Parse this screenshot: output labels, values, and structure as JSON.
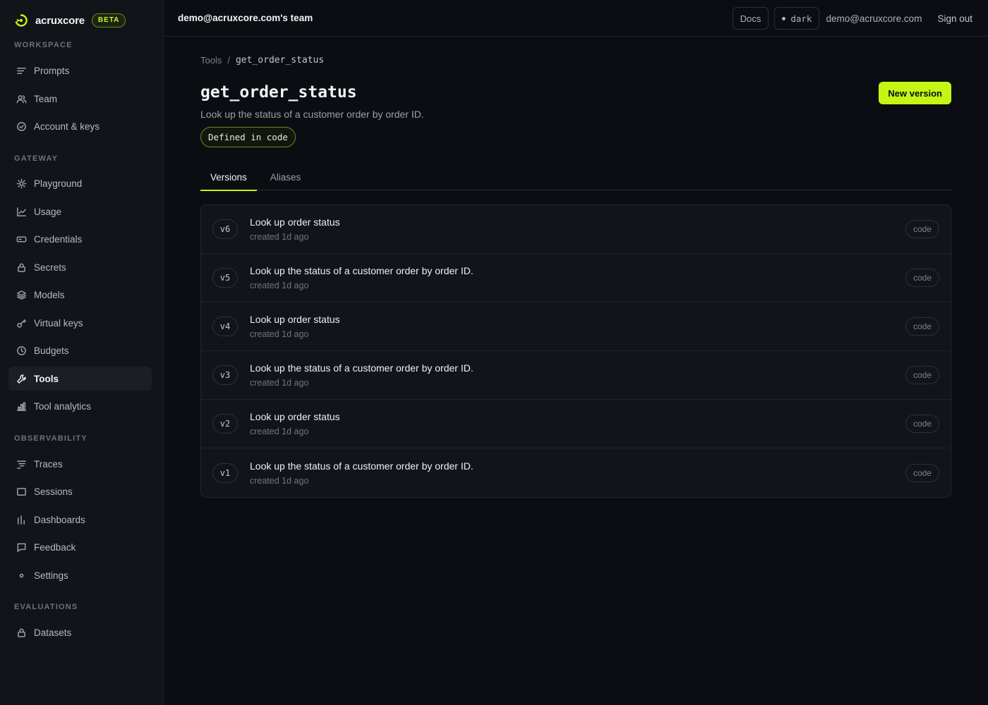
{
  "brand": {
    "name": "acruxcore",
    "badge": "BETA",
    "accent": "#c5f514"
  },
  "sidebar": {
    "sections": [
      {
        "title": "WORKSPACE",
        "items": [
          {
            "label": "Prompts",
            "icon": "list-icon"
          },
          {
            "label": "Team",
            "icon": "users-icon"
          },
          {
            "label": "Account & keys",
            "icon": "check-circle-icon"
          }
        ]
      },
      {
        "title": "GATEWAY",
        "items": [
          {
            "label": "Playground",
            "icon": "sun-icon"
          },
          {
            "label": "Usage",
            "icon": "line-chart-icon"
          },
          {
            "label": "Credentials",
            "icon": "card-icon"
          },
          {
            "label": "Secrets",
            "icon": "lock-icon"
          },
          {
            "label": "Models",
            "icon": "layers-icon"
          },
          {
            "label": "Virtual keys",
            "icon": "key-icon"
          },
          {
            "label": "Budgets",
            "icon": "clock-icon"
          },
          {
            "label": "Tools",
            "icon": "wrench-icon",
            "active": true
          },
          {
            "label": "Tool analytics",
            "icon": "bar-chart-icon"
          }
        ]
      },
      {
        "title": "OBSERVABILITY",
        "items": [
          {
            "label": "Traces",
            "icon": "traces-icon"
          },
          {
            "label": "Sessions",
            "icon": "square-icon"
          },
          {
            "label": "Dashboards",
            "icon": "bars-icon"
          },
          {
            "label": "Feedback",
            "icon": "message-icon"
          },
          {
            "label": "Settings",
            "icon": "dot-icon"
          }
        ]
      },
      {
        "title": "EVALUATIONS",
        "items": [
          {
            "label": "Datasets",
            "icon": "lock-icon"
          }
        ]
      }
    ]
  },
  "header": {
    "team": "demo@acruxcore.com's team",
    "docs": "Docs",
    "theme": "dark",
    "email": "demo@acruxcore.com",
    "signout": "Sign out"
  },
  "breadcrumb": {
    "parent": "Tools",
    "sep": "/",
    "current": "get_order_status"
  },
  "tool": {
    "name": "get_order_status",
    "description": "Look up the status of a customer order by order ID.",
    "badge": "Defined in code",
    "new_version": "New version"
  },
  "tabs": [
    {
      "label": "Versions",
      "active": true
    },
    {
      "label": "Aliases"
    }
  ],
  "versions": [
    {
      "id": "v6",
      "title": "Look up order status",
      "meta": "created 1d ago",
      "source": "code"
    },
    {
      "id": "v5",
      "title": "Look up the status of a customer order by order ID.",
      "meta": "created 1d ago",
      "source": "code"
    },
    {
      "id": "v4",
      "title": "Look up order status",
      "meta": "created 1d ago",
      "source": "code"
    },
    {
      "id": "v3",
      "title": "Look up the status of a customer order by order ID.",
      "meta": "created 1d ago",
      "source": "code"
    },
    {
      "id": "v2",
      "title": "Look up order status",
      "meta": "created 1d ago",
      "source": "code"
    },
    {
      "id": "v1",
      "title": "Look up the status of a customer order by order ID.",
      "meta": "created 1d ago",
      "source": "code"
    }
  ]
}
